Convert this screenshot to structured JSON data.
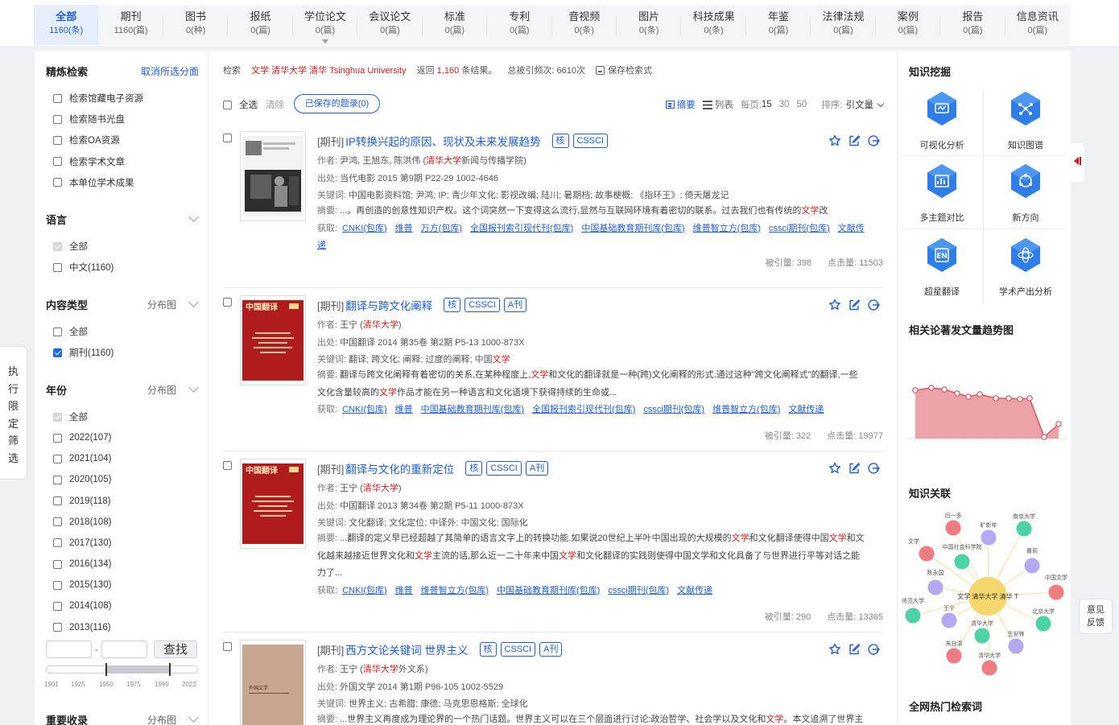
{
  "tabs": [
    {
      "label": "全部",
      "count": "1160(条)"
    },
    {
      "label": "期刊",
      "count": "1160(篇)"
    },
    {
      "label": "图书",
      "count": "0(种)"
    },
    {
      "label": "报纸",
      "count": "0(篇)"
    },
    {
      "label": "学位论文",
      "count": "0(篇)"
    },
    {
      "label": "会议论文",
      "count": "0(篇)"
    },
    {
      "label": "标准",
      "count": "0(篇)"
    },
    {
      "label": "专利",
      "count": "0(篇)"
    },
    {
      "label": "音视频",
      "count": "0(条)"
    },
    {
      "label": "图片",
      "count": "0(条)"
    },
    {
      "label": "科技成果",
      "count": "0(条)"
    },
    {
      "label": "年鉴",
      "count": "0(篇)"
    },
    {
      "label": "法律法规",
      "count": "0(篇)"
    },
    {
      "label": "案例",
      "count": "0(篇)"
    },
    {
      "label": "报告",
      "count": "0(篇)"
    },
    {
      "label": "信息资讯",
      "count": "0(篇)"
    }
  ],
  "left": {
    "refine_title": "精炼检索",
    "cancel_all": "取消所选分面",
    "scope_items": [
      "检索馆藏电子资源",
      "检索随书光盘",
      "检索OA资源",
      "检索学术文章",
      "本单位学术成果"
    ],
    "language_title": "语言",
    "language_items": [
      "全部",
      "中文(1160)"
    ],
    "content_title": "内容类型",
    "content_dist": "分布图",
    "content_items": [
      "全部",
      "期刊(1160)"
    ],
    "year_title": "年份",
    "year_dist": "分布图",
    "year_items": [
      "全部",
      "2022(107)",
      "2021(104)",
      "2020(105)",
      "2019(118)",
      "2018(108)",
      "2017(130)",
      "2016(134)",
      "2015(130)",
      "2014(108)",
      "2013(116)"
    ],
    "find_button": "查找",
    "slider_ticks": [
      "1901",
      "1925",
      "1950",
      "1975",
      "1999",
      "2022"
    ],
    "important_title": "重要收录",
    "important_dist": "分布图"
  },
  "side_pull": [
    "执",
    "行",
    "限",
    "定",
    "筛",
    "选"
  ],
  "search": {
    "label": "检索",
    "query": "文学 清华大学 清华 Tsinghua University",
    "returned_prefix": "返回",
    "returned_count": "1,160",
    "returned_suffix": "条结果。",
    "total_cited_label": "总被引频次:",
    "total_cited": "6610次",
    "save_label": "保存检索式"
  },
  "toolbar": {
    "select_all": "全选",
    "clear": "清除",
    "saved_topics": "已保存的题录(0)",
    "abstract": "摘要",
    "list": "列表",
    "per_page_label": "每页:",
    "per_page_current": "15",
    "per_page_30": "30",
    "per_page_50": "50",
    "sort_label": "排序:",
    "sort_value": "引文量"
  },
  "results": [
    {
      "kind": "[期刊]",
      "title": "IP转换兴起的原因、现状及未来发展趋势",
      "tags": [
        "核",
        "CSSCI"
      ],
      "authors_label": "作者:",
      "authors_pre": "尹鸿, 王旭东, 陈洪伟 (",
      "authors_red": "清华大学",
      "authors_post": "新闻与传播学院)",
      "source_label": "出处:",
      "source": "当代电影 2015 第9期 P22-29  1002-4646",
      "keywords_label": "关键词:",
      "keywords": "中国电影资料馆; 尹鸿; IP; 青少年文化; 影视改编; 陆川; 暑期档; 故事梗概; 《指环王》; 倚天屠龙记",
      "abstract_label": "摘要:",
      "abstract_pre": "...。再创造的创意性知识产权。这个词突然一下变得这么流行,显然与互联网环境有着密切的联系。过去我们也有传统的",
      "abstract_red": "文学",
      "abstract_post": "改",
      "acquire_label": "获取:",
      "links": [
        "CNKI(包库)",
        "维普",
        "万方(包库)",
        "全国报刊索引现代刊(包库)",
        "中国基础教育期刊库(包库)",
        "维普智立方(包库)",
        "cssci期刊(包库)",
        "文献传递"
      ],
      "cited_label": "被引量:",
      "cited": "398",
      "clicks_label": "点击量:",
      "clicks": "11503",
      "cover": "film"
    },
    {
      "kind": "[期刊]",
      "title": "翻译与跨文化阐释",
      "tags": [
        "核",
        "CSSCI",
        "A刊"
      ],
      "authors_label": "作者:",
      "authors_pre": "王宁 (",
      "authors_red": "清华大学",
      "authors_post": ")",
      "source_label": "出处:",
      "source": "中国翻译 2014 第35卷 第2期 P5-13  1000-873X",
      "keywords_label": "关键词:",
      "keywords_pre": "翻译; 跨文化; 阐释; 过度的阐释; 中国",
      "keywords_red": "文学",
      "abstract_label": "摘要:",
      "abstract_pre": "翻译与跨文化阐释有着密切的关系,在某种程度上,",
      "abstract_red": "文学",
      "abstract_mid": "和文化的翻译就是一种(跨)文化阐释的形式.通过这种\"跨文化阐释式\"的翻译,一些文化含量较高的",
      "abstract_red2": "文学",
      "abstract_post": "作品才能在另一种语言和文化语境下获得持续的生命或...",
      "acquire_label": "获取:",
      "links": [
        "CNKI(包库)",
        "维普",
        "中国基础教育期刊库(包库)",
        "全国报刊索引现代刊(包库)",
        "cssci期刊(包库)",
        "维普智立方(包库)",
        "文献传递"
      ],
      "cited_label": "被引量:",
      "cited": "322",
      "clicks_label": "点击量:",
      "clicks": "19977",
      "cover": "red",
      "cover_text": "中国翻译"
    },
    {
      "kind": "[期刊]",
      "title": "翻译与文化的重新定位",
      "tags": [
        "核",
        "CSSCI",
        "A刊"
      ],
      "authors_label": "作者:",
      "authors_pre": "王宁 (",
      "authors_red": "清华大学",
      "authors_post": ")",
      "source_label": "出处:",
      "source": "中国翻译 2013 第34卷 第2期 P5-11  1000-873X",
      "keywords_label": "关键词:",
      "keywords": "文化翻译; 文化定位; 中译外; 中国文化; 国际化",
      "abstract_label": "摘要:",
      "abstract_pre": "...翻译的定义早已经超越了其简单的语言文字上的转换功能.如果说20世纪上半叶中国出现的大规模的",
      "abstract_red": "文学",
      "abstract_mid": "和文化翻译使得中国",
      "abstract_red2": "文学",
      "abstract_mid2": "和文化越来越接近世界文化和",
      "abstract_red3": "文学",
      "abstract_mid3": "主流的话,那么近一二十年来中国",
      "abstract_red4": "文学",
      "abstract_post": "和文化翻译的实践则使得中国文学和文化具备了与世界进行平等对话之能力了...",
      "acquire_label": "获取:",
      "links": [
        "CNKI(包库)",
        "维普",
        "维普智立方(包库)",
        "中国基础教育期刊库(包库)",
        "cssci期刊(包库)",
        "文献传递"
      ],
      "cited_label": "被引量:",
      "cited": "290",
      "clicks_label": "点击量:",
      "clicks": "13365",
      "cover": "red",
      "cover_text": "中国翻译"
    },
    {
      "kind": "[期刊]",
      "title": "西方文论关键词 世界主义",
      "tags": [
        "核",
        "CSSCI",
        "A刊"
      ],
      "authors_label": "作者:",
      "authors_pre": "王宁 (",
      "authors_red": "清华大学",
      "authors_post": "外文系)",
      "source_label": "出处:",
      "source": "外国文学 2014 第1期 P96-105  1002-5529",
      "keywords_label": "关键词:",
      "keywords": "世界主义; 古希腊; 康德; 马克思恩格斯; 全球化",
      "abstract_label": "摘要:",
      "abstract_pre": "...世界主义再度成为理论界的一个热门话题。世界主义可以在三个层面进行讨论:政治哲学、社会学以及文化和",
      "abstract_red": "文学",
      "abstract_post": "。本文追溯了世界主",
      "cover": "tan",
      "cover_text": "外国文学"
    }
  ],
  "right": {
    "mining_title": "知识挖掘",
    "tools": [
      "可视化分析",
      "知识图谱",
      "多主题对比",
      "新方向",
      "超星翻译",
      "学术产出分析"
    ],
    "trend_title": "相关论著发文量趋势图",
    "relation_title": "知识关联",
    "hot_title": "全网热门检索词",
    "network_center": "文学 清华大学 清华 T",
    "network_nodes": [
      "闫一多",
      "旷新年",
      "南京大学",
      "文学",
      "中国社会科学院",
      "曹莉",
      "陈永国",
      "中国文学",
      "师范大学",
      "王宁",
      "清华大学",
      "北京大学",
      "朱自清",
      "生安锋",
      "清华大学"
    ]
  },
  "feedback": [
    "意见",
    "反馈"
  ]
}
